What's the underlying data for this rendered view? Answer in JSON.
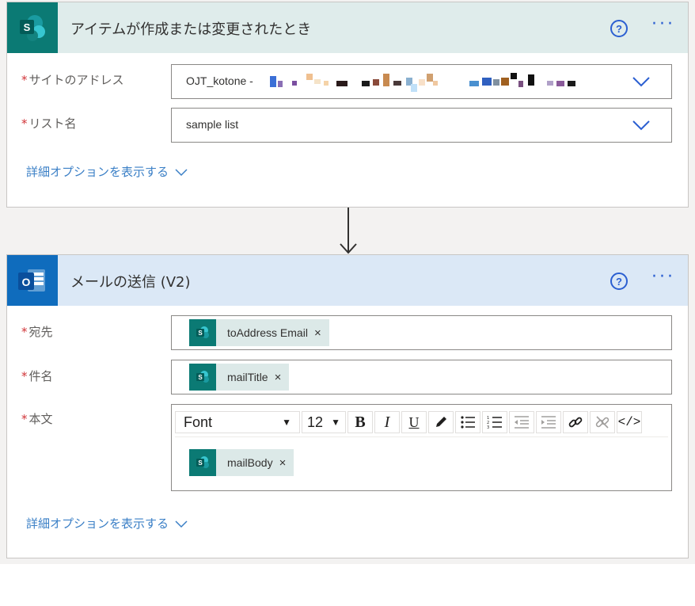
{
  "trigger": {
    "title": "アイテムが作成または変更されたとき",
    "site_label": "サイトのアドレス",
    "site_value": "OJT_kotone -",
    "list_label": "リスト名",
    "list_value": "sample list",
    "advanced_link": "詳細オプションを表示する",
    "required_mark": "*",
    "help_icon": "?",
    "more_icon": "···"
  },
  "action": {
    "title": "メールの送信 (V2)",
    "to_label": "宛先",
    "to_token": "toAddress Email",
    "subject_label": "件名",
    "subject_token": "mailTitle",
    "body_label": "本文",
    "body_token": "mailBody",
    "advanced_link": "詳細オプションを表示する",
    "required_mark": "*",
    "help_icon": "?",
    "more_icon": "···",
    "token_remove": "×",
    "toolbar": {
      "font_label": "Font",
      "size_label": "12",
      "bold": "B",
      "italic": "I",
      "underline": "U",
      "code": "</>"
    }
  },
  "colors": {
    "sharepoint_teal": "#0b7a74",
    "outlook_blue": "#0f6cbd",
    "link_blue": "#3a7fc6",
    "required_red": "#d13438"
  }
}
